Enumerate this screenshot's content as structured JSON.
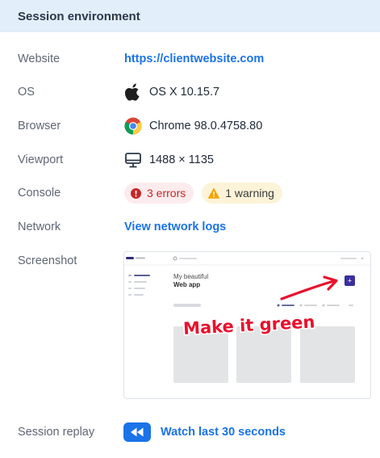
{
  "header": {
    "title": "Session environment"
  },
  "rows": {
    "website": {
      "label": "Website",
      "value": "https://clientwebsite.com"
    },
    "os": {
      "label": "OS",
      "value": "OS X 10.15.7",
      "icon": "apple-icon"
    },
    "browser": {
      "label": "Browser",
      "value": "Chrome 98.0.4758.80",
      "icon": "chrome-icon"
    },
    "viewport": {
      "label": "Viewport",
      "value": "1488 × 1135",
      "icon": "monitor-icon"
    },
    "console": {
      "label": "Console",
      "errors": "3 errors",
      "warning": "1 warning"
    },
    "network": {
      "label": "Network",
      "value": "View network logs"
    },
    "screenshot": {
      "label": "Screenshot",
      "preview_subtitle": "My beautiful",
      "preview_title": "Web app",
      "annotation": "Make it green"
    },
    "replay": {
      "label": "Session replay",
      "value": "Watch last 30 seconds",
      "icon": "rewind-icon"
    }
  },
  "colors": {
    "accent": "#1a73e8",
    "header_bg": "#e3eefb",
    "error_bg": "#fdeced",
    "error": "#c62828",
    "warning_bg": "#fdf3d8",
    "warning": "#f5a300",
    "annotation": "#e8112d",
    "preview_button": "#3b2f9e"
  }
}
